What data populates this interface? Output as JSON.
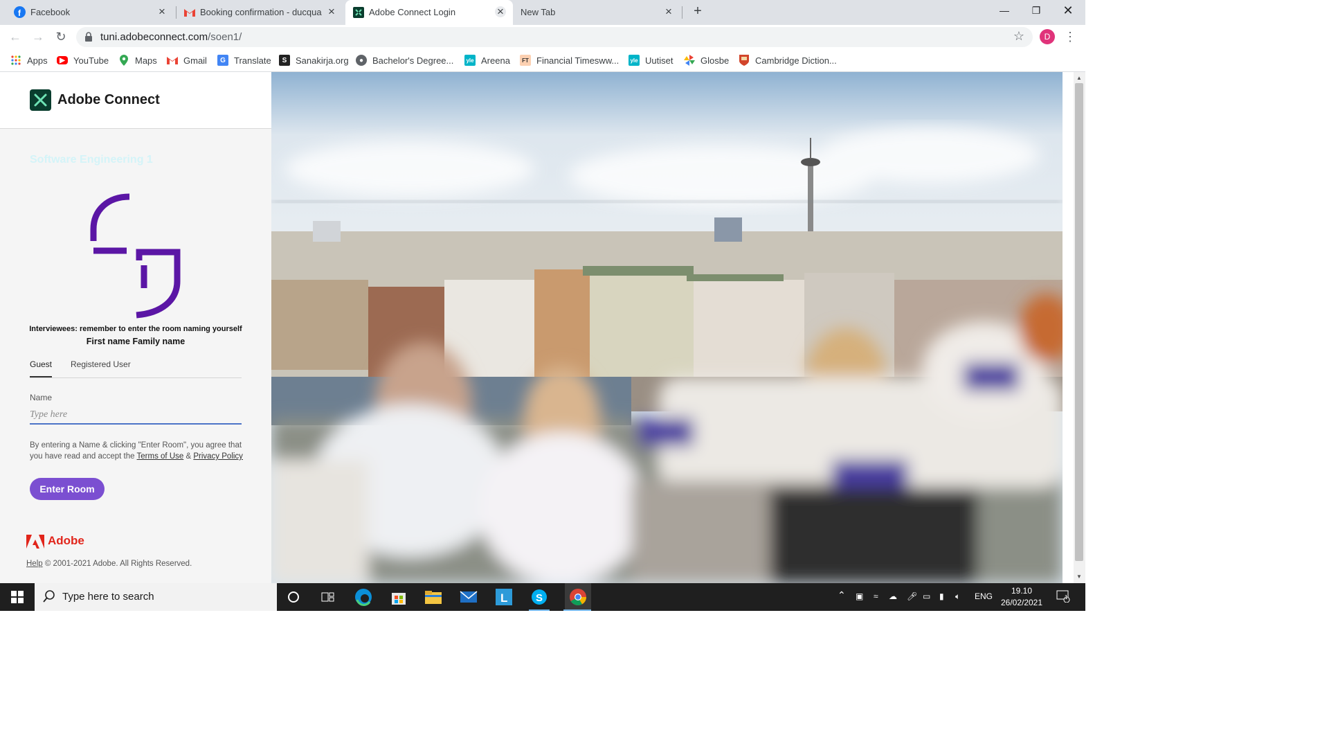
{
  "browser": {
    "tabs": [
      {
        "title": "Facebook",
        "icon": "facebook-icon"
      },
      {
        "title": "Booking confirmation - ducquan",
        "icon": "gmail-icon"
      },
      {
        "title": "Adobe Connect Login",
        "icon": "adobe-connect-icon",
        "active": true
      },
      {
        "title": "New Tab",
        "icon": ""
      }
    ],
    "url_host": "tuni.adobeconnect.com",
    "url_path": "/soen1/",
    "profile_initial": "D",
    "bookmarks": [
      {
        "label": "Apps",
        "icon": "apps-grid-icon"
      },
      {
        "label": "YouTube",
        "icon": "youtube-icon"
      },
      {
        "label": "Maps",
        "icon": "maps-icon"
      },
      {
        "label": "Gmail",
        "icon": "gmail-icon"
      },
      {
        "label": "Translate",
        "icon": "translate-icon"
      },
      {
        "label": "Sanakirja.org",
        "icon": "sanakirja-icon"
      },
      {
        "label": "Bachelor's Degree...",
        "icon": "globe-icon"
      },
      {
        "label": "Areena",
        "icon": "yle-icon"
      },
      {
        "label": "Financial Timesww...",
        "icon": "ft-icon"
      },
      {
        "label": "Uutiset",
        "icon": "yle-icon"
      },
      {
        "label": "Glosbe",
        "icon": "glosbe-icon"
      },
      {
        "label": "Cambridge Diction...",
        "icon": "cambridge-icon"
      }
    ]
  },
  "login": {
    "brand": "Adobe Connect",
    "room_name": "Software Engineering 1",
    "note_line1": "Interviewees: remember to enter the room naming yourself",
    "note_line2": "First name Family name",
    "tab_guest": "Guest",
    "tab_registered": "Registered User",
    "name_label": "Name",
    "name_placeholder": "Type here",
    "agree_prefix": "By entering a Name & clicking \"Enter Room\", you agree that you have read and accept the",
    "terms_link": "Terms of Use",
    "amp": "&",
    "privacy_link": "Privacy Policy",
    "enter_button": "Enter Room",
    "adobe_wordmark": "Adobe",
    "help_link": "Help",
    "copyright": "© 2001-2021 Adobe. All Rights Reserved."
  },
  "taskbar": {
    "search_placeholder": "Type here to search",
    "language": "ENG",
    "time": "19.10",
    "date": "26/02/2021",
    "notification_count": "1"
  },
  "colors": {
    "accent_purple": "#7b4fd1",
    "adobe_red": "#e1251b",
    "input_underline": "#4c74c7"
  }
}
